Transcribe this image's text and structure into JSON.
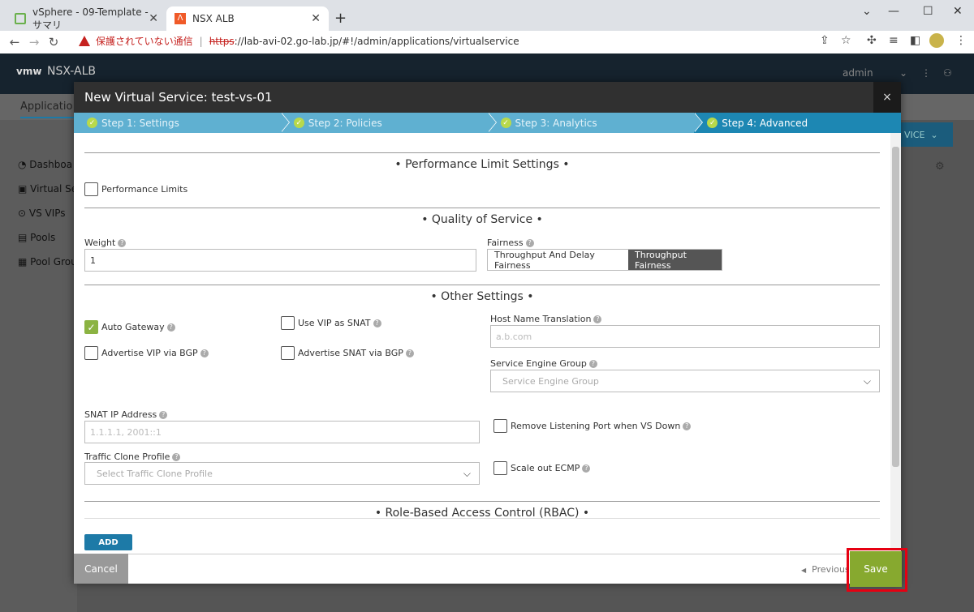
{
  "browser": {
    "tabs": [
      {
        "title": "vSphere - 09-Template - サマリ",
        "active": false
      },
      {
        "title": "NSX ALB",
        "active": true
      }
    ],
    "address": {
      "security_label": "保護されていない通信",
      "scheme": "https",
      "rest": "://lab-avi-02.go-lab.jp/#!/admin/applications/virtualservice"
    }
  },
  "app": {
    "logo": "vmw",
    "name": "NSX-ALB",
    "user": "admin",
    "subnav": "Applicatio",
    "sidebar": [
      "Dashboa",
      "Virtual Se",
      "VS VIPs",
      "Pools",
      "Pool Grou"
    ],
    "create_partial": "VICE"
  },
  "modal": {
    "title": "New Virtual Service: test-vs-01",
    "close_glyph": "×",
    "steps": [
      {
        "label": "Step 1: Settings",
        "active": false
      },
      {
        "label": "Step 2: Policies",
        "active": false
      },
      {
        "label": "Step 3: Analytics",
        "active": false
      },
      {
        "label": "Step 4: Advanced",
        "active": true
      }
    ],
    "performance": {
      "title": "• Performance Limit Settings •",
      "performance_limits": "Performance Limits"
    },
    "qos": {
      "title": "• Quality of Service •",
      "weight_label": "Weight",
      "weight_value": "1",
      "fairness_label": "Fairness",
      "fairness_options": [
        "Throughput And Delay Fairness",
        "Throughput Fairness"
      ],
      "fairness_selected": "Throughput Fairness"
    },
    "other": {
      "title": "• Other Settings •",
      "auto_gateway": "Auto Gateway",
      "use_vip_snat": "Use VIP as SNAT",
      "advertise_vip": "Advertise VIP via BGP",
      "advertise_snat": "Advertise SNAT via BGP",
      "host_name_label": "Host Name Translation",
      "host_name_placeholder": "a.b.com",
      "seg_label": "Service Engine Group",
      "seg_placeholder": "Service Engine Group",
      "snat_label": "SNAT IP Address",
      "snat_placeholder": "1.1.1.1, 2001::1",
      "remove_port": "Remove Listening Port when VS Down",
      "traffic_clone_label": "Traffic Clone Profile",
      "traffic_clone_placeholder": "Select Traffic Clone Profile",
      "scale_ecmp": "Scale out ECMP"
    },
    "rbac": {
      "title": "• Role-Based Access Control (RBAC) •",
      "add": "ADD"
    },
    "footer": {
      "cancel": "Cancel",
      "previous": "Previous",
      "save": "Save"
    }
  }
}
